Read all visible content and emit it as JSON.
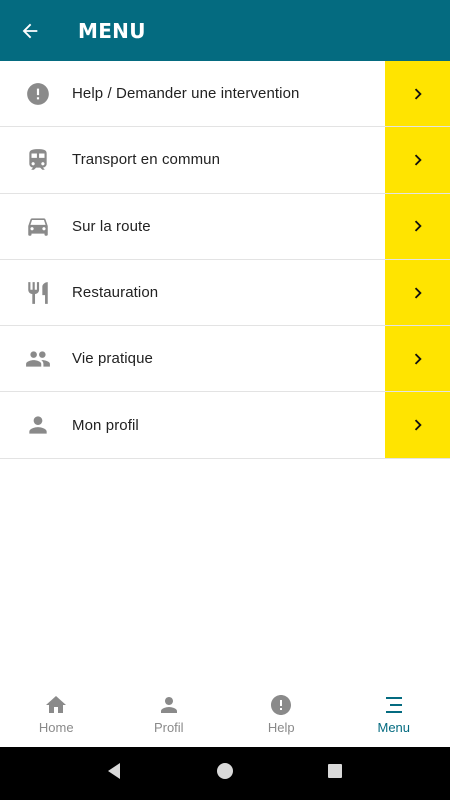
{
  "header": {
    "title": "MENU",
    "back_icon": "arrow-left-icon"
  },
  "menu": {
    "items": [
      {
        "label": "Help / Demander une intervention",
        "icon": "alert-circle-icon"
      },
      {
        "label": "Transport en commun",
        "icon": "train-icon"
      },
      {
        "label": "Sur la route",
        "icon": "car-icon"
      },
      {
        "label": "Restauration",
        "icon": "restaurant-icon"
      },
      {
        "label": "Vie pratique",
        "icon": "people-icon"
      },
      {
        "label": "Mon profil",
        "icon": "person-icon"
      }
    ],
    "chevron_color": "#ffe400"
  },
  "bottom_nav": {
    "items": [
      {
        "label": "Home",
        "icon": "home-icon"
      },
      {
        "label": "Profil",
        "icon": "person-icon"
      },
      {
        "label": "Help",
        "icon": "alert-circle-icon"
      },
      {
        "label": "Menu",
        "icon": "menu-icon"
      }
    ],
    "active": "Menu"
  },
  "colors": {
    "appbar": "#046b80",
    "accent": "#ffe400",
    "icon_gray": "#8a8a8a"
  },
  "system_nav": {
    "buttons": [
      "back",
      "home",
      "recents"
    ]
  }
}
